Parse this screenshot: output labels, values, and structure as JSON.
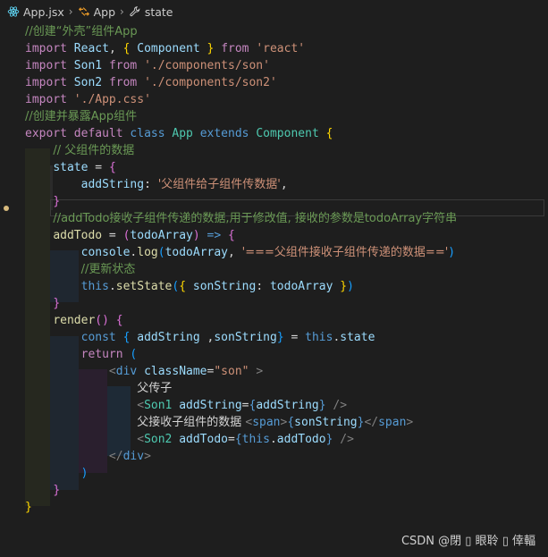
{
  "breadcrumb": {
    "file": "App.jsx",
    "component": "App",
    "member": "state"
  },
  "code_lines": [
    [
      [
        "cmt",
        "//创建“外壳”组件App"
      ]
    ],
    [
      [
        "kw",
        "import"
      ],
      [
        "plain",
        " "
      ],
      [
        "var",
        "React"
      ],
      [
        "plain",
        ", "
      ],
      [
        "br1",
        "{"
      ],
      [
        "plain",
        " "
      ],
      [
        "var",
        "Component"
      ],
      [
        "plain",
        " "
      ],
      [
        "br1",
        "}"
      ],
      [
        "plain",
        " "
      ],
      [
        "kw",
        "from"
      ],
      [
        "plain",
        " "
      ],
      [
        "str",
        "'react'"
      ]
    ],
    [
      [
        "kw",
        "import"
      ],
      [
        "plain",
        " "
      ],
      [
        "var",
        "Son1"
      ],
      [
        "plain",
        " "
      ],
      [
        "kw",
        "from"
      ],
      [
        "plain",
        " "
      ],
      [
        "str",
        "'./components/son'"
      ]
    ],
    [
      [
        "kw",
        "import"
      ],
      [
        "plain",
        " "
      ],
      [
        "var",
        "Son2"
      ],
      [
        "plain",
        " "
      ],
      [
        "kw",
        "from"
      ],
      [
        "plain",
        " "
      ],
      [
        "str",
        "'./components/son2'"
      ]
    ],
    [
      [
        "kw",
        "import"
      ],
      [
        "plain",
        " "
      ],
      [
        "str",
        "'./App.css'"
      ]
    ],
    [
      [
        "cmt",
        "//创建并暴露App组件"
      ]
    ],
    [
      [
        "kw",
        "export"
      ],
      [
        "plain",
        " "
      ],
      [
        "kw",
        "default"
      ],
      [
        "plain",
        " "
      ],
      [
        "kwb",
        "class"
      ],
      [
        "plain",
        " "
      ],
      [
        "cls",
        "App"
      ],
      [
        "plain",
        " "
      ],
      [
        "kwb",
        "extends"
      ],
      [
        "plain",
        " "
      ],
      [
        "cls",
        "Component"
      ],
      [
        "plain",
        " "
      ],
      [
        "br1",
        "{"
      ]
    ],
    [
      [
        "plain",
        "    "
      ],
      [
        "cmt",
        "// 父组件的数据"
      ]
    ],
    [
      [
        "plain",
        "    "
      ],
      [
        "var",
        "state"
      ],
      [
        "plain",
        " = "
      ],
      [
        "br2",
        "{"
      ]
    ],
    [
      [
        "plain",
        "        "
      ],
      [
        "var",
        "addString"
      ],
      [
        "plain",
        ": "
      ],
      [
        "str",
        "'父组件给子组件传数据'"
      ],
      [
        "plain",
        ","
      ]
    ],
    [
      [
        "plain",
        "    "
      ],
      [
        "br2",
        "}"
      ]
    ],
    [
      [
        "plain",
        "    "
      ],
      [
        "cmt",
        "//addTodo接收子组件传递的数据,用于修改值, 接收的参数是todoArray字符串"
      ]
    ],
    [
      [
        "plain",
        "    "
      ],
      [
        "fn",
        "addTodo"
      ],
      [
        "plain",
        " = "
      ],
      [
        "br2",
        "("
      ],
      [
        "var",
        "todoArray"
      ],
      [
        "br2",
        ")"
      ],
      [
        "plain",
        " "
      ],
      [
        "kwb",
        "=>"
      ],
      [
        "plain",
        " "
      ],
      [
        "br2",
        "{"
      ]
    ],
    [
      [
        "plain",
        "        "
      ],
      [
        "var",
        "console"
      ],
      [
        "plain",
        "."
      ],
      [
        "fn",
        "log"
      ],
      [
        "br3",
        "("
      ],
      [
        "var",
        "todoArray"
      ],
      [
        "plain",
        ", "
      ],
      [
        "str",
        "'===父组件接收子组件传递的数据=='"
      ],
      [
        "br3",
        ")"
      ]
    ],
    [
      [
        "plain",
        "        "
      ],
      [
        "cmt",
        "//更新状态"
      ]
    ],
    [
      [
        "plain",
        "        "
      ],
      [
        "kwb",
        "this"
      ],
      [
        "plain",
        "."
      ],
      [
        "fn",
        "setState"
      ],
      [
        "br3",
        "("
      ],
      [
        "br1",
        "{"
      ],
      [
        "plain",
        " "
      ],
      [
        "var",
        "sonString"
      ],
      [
        "plain",
        ": "
      ],
      [
        "var",
        "todoArray"
      ],
      [
        "plain",
        " "
      ],
      [
        "br1",
        "}"
      ],
      [
        "br3",
        ")"
      ]
    ],
    [
      [
        "plain",
        "    "
      ],
      [
        "br2",
        "}"
      ]
    ],
    [
      [
        "plain",
        "    "
      ],
      [
        "fn",
        "render"
      ],
      [
        "br2",
        "("
      ],
      [
        "br2",
        ")"
      ],
      [
        "plain",
        " "
      ],
      [
        "br2",
        "{"
      ]
    ],
    [
      [
        "plain",
        "        "
      ],
      [
        "kwb",
        "const"
      ],
      [
        "plain",
        " "
      ],
      [
        "br3",
        "{"
      ],
      [
        "plain",
        " "
      ],
      [
        "var",
        "addString"
      ],
      [
        "plain",
        " ,"
      ],
      [
        "var",
        "sonString"
      ],
      [
        "br3",
        "}"
      ],
      [
        "plain",
        " = "
      ],
      [
        "kwb",
        "this"
      ],
      [
        "plain",
        "."
      ],
      [
        "var",
        "state"
      ]
    ],
    [
      [
        "plain",
        "        "
      ],
      [
        "kw",
        "return"
      ],
      [
        "plain",
        " "
      ],
      [
        "br3",
        "("
      ]
    ],
    [
      [
        "plain",
        "            "
      ],
      [
        "punct",
        "<"
      ],
      [
        "tag",
        "div"
      ],
      [
        "plain",
        " "
      ],
      [
        "attr",
        "className"
      ],
      [
        "plain",
        "="
      ],
      [
        "str",
        "\"son\""
      ],
      [
        "plain",
        " "
      ],
      [
        "punct",
        ">"
      ]
    ],
    [
      [
        "plain",
        "                "
      ],
      [
        "plain",
        "父传子"
      ]
    ],
    [
      [
        "plain",
        "                "
      ],
      [
        "punct",
        "<"
      ],
      [
        "cls",
        "Son1"
      ],
      [
        "plain",
        " "
      ],
      [
        "attr",
        "addString"
      ],
      [
        "plain",
        "="
      ],
      [
        "kwb",
        "{"
      ],
      [
        "var",
        "addString"
      ],
      [
        "kwb",
        "}"
      ],
      [
        "plain",
        " "
      ],
      [
        "punct",
        "/>"
      ]
    ],
    [
      [
        "plain",
        "                "
      ],
      [
        "plain",
        "父接收子组件的数据 "
      ],
      [
        "punct",
        "<"
      ],
      [
        "tag",
        "span"
      ],
      [
        "punct",
        ">"
      ],
      [
        "kwb",
        "{"
      ],
      [
        "var",
        "sonString"
      ],
      [
        "kwb",
        "}"
      ],
      [
        "punct",
        "</"
      ],
      [
        "tag",
        "span"
      ],
      [
        "punct",
        ">"
      ]
    ],
    [
      [
        "plain",
        "                "
      ],
      [
        "punct",
        "<"
      ],
      [
        "cls",
        "Son2"
      ],
      [
        "plain",
        " "
      ],
      [
        "attr",
        "addTodo"
      ],
      [
        "plain",
        "="
      ],
      [
        "kwb",
        "{"
      ],
      [
        "kwb",
        "this"
      ],
      [
        "plain",
        "."
      ],
      [
        "var",
        "addTodo"
      ],
      [
        "kwb",
        "}"
      ],
      [
        "plain",
        " "
      ],
      [
        "punct",
        "/>"
      ]
    ],
    [
      [
        "plain",
        "            "
      ],
      [
        "punct",
        "</"
      ],
      [
        "tag",
        "div"
      ],
      [
        "punct",
        ">"
      ]
    ],
    [
      [
        "plain",
        "        "
      ],
      [
        "br3",
        ")"
      ]
    ],
    [
      [
        "plain",
        "    "
      ],
      [
        "br2",
        "}"
      ]
    ],
    [
      [
        "br1",
        "}"
      ]
    ]
  ],
  "watermark": "CSDN @閉 ▯ 眼聆 ▯ 倖輻",
  "colors": {
    "background": "#1e1e1e",
    "comment": "#6a9955",
    "keyword": "#c586c0",
    "keyword_blue": "#569cd6",
    "string": "#ce9178",
    "variable": "#9cdcfe",
    "class": "#4ec9b0",
    "function": "#dcdcaa"
  }
}
